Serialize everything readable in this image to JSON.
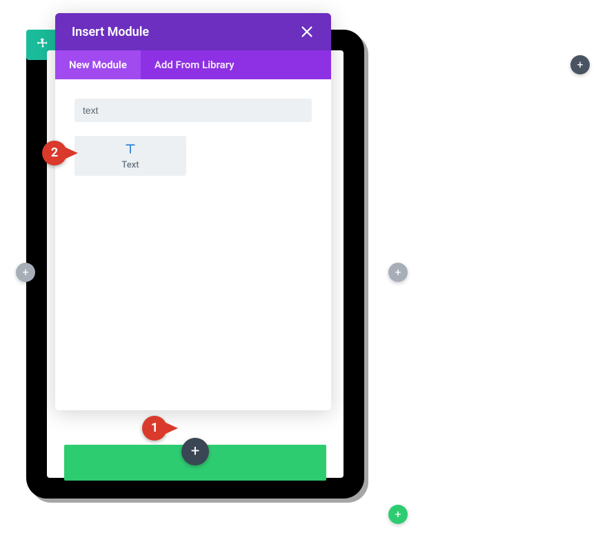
{
  "modal": {
    "title": "Insert Module",
    "tabs": {
      "new_module": "New Module",
      "add_from_library": "Add From Library"
    },
    "search": {
      "value": "text"
    },
    "modules": {
      "0": {
        "label": "Text"
      }
    }
  },
  "callouts": {
    "step1": "1",
    "step2": "2"
  },
  "glyphs": {
    "plus": "+"
  }
}
